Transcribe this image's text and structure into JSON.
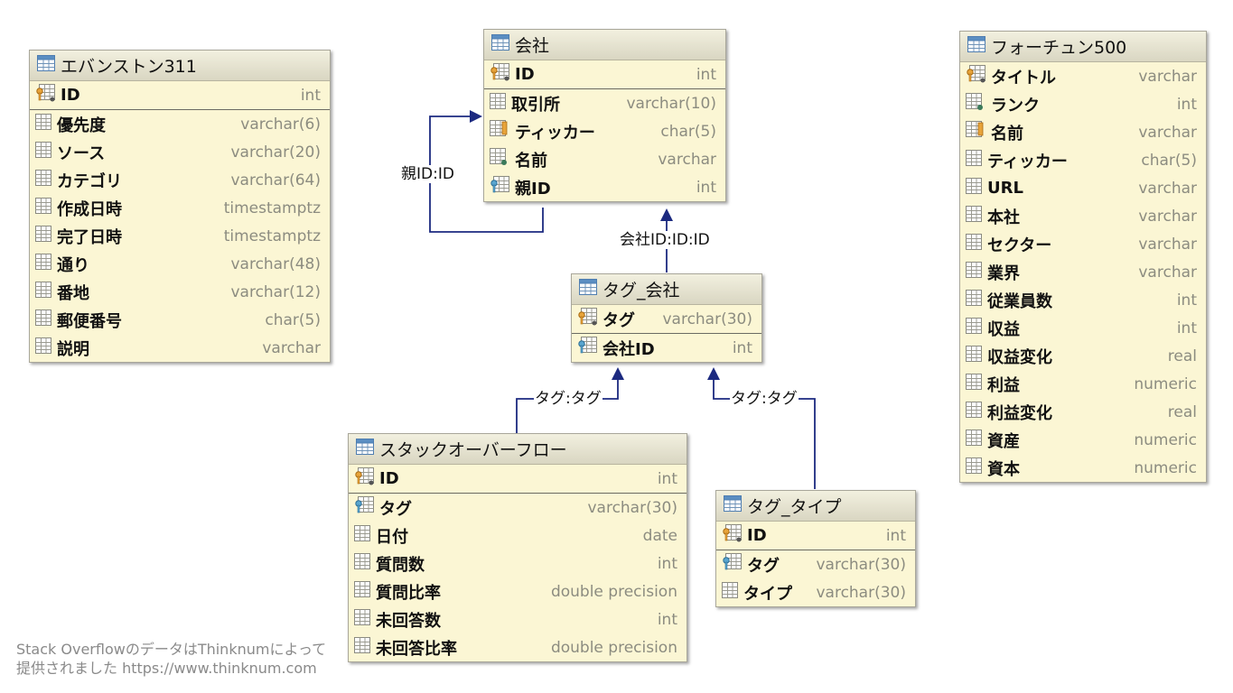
{
  "tables": [
    {
      "id": "evanston",
      "title": "エバンストン311",
      "pk": [
        {
          "name": "ID",
          "type": "int",
          "icon": "pk"
        }
      ],
      "columns": [
        {
          "name": "優先度",
          "type": "varchar(6)",
          "icon": "col"
        },
        {
          "name": "ソース",
          "type": "varchar(20)",
          "icon": "col"
        },
        {
          "name": "カテゴリ",
          "type": "varchar(64)",
          "icon": "col"
        },
        {
          "name": "作成日時",
          "type": "timestamptz",
          "icon": "col"
        },
        {
          "name": "完了日時",
          "type": "timestamptz",
          "icon": "col"
        },
        {
          "name": "通り",
          "type": "varchar(48)",
          "icon": "col"
        },
        {
          "name": "番地",
          "type": "varchar(12)",
          "icon": "col"
        },
        {
          "name": "郵便番号",
          "type": "char(5)",
          "icon": "col"
        },
        {
          "name": "説明",
          "type": "varchar",
          "icon": "col"
        }
      ]
    },
    {
      "id": "company",
      "title": "会社",
      "pk": [
        {
          "name": "ID",
          "type": "int",
          "icon": "pk"
        }
      ],
      "columns": [
        {
          "name": "取引所",
          "type": "varchar(10)",
          "icon": "col"
        },
        {
          "name": "ティッカー",
          "type": "char(5)",
          "icon": "index"
        },
        {
          "name": "名前",
          "type": "varchar",
          "icon": "nullable"
        },
        {
          "name": "親ID",
          "type": "int",
          "icon": "fk"
        }
      ]
    },
    {
      "id": "tag_company",
      "title": "タグ_会社",
      "pk": [
        {
          "name": "タグ",
          "type": "varchar(30)",
          "icon": "pk"
        }
      ],
      "columns": [
        {
          "name": "会社ID",
          "type": "int",
          "icon": "fk"
        }
      ]
    },
    {
      "id": "stackoverflow",
      "title": "スタックオーバーフロー",
      "pk": [
        {
          "name": "ID",
          "type": "int",
          "icon": "pk"
        }
      ],
      "columns": [
        {
          "name": "タグ",
          "type": "varchar(30)",
          "icon": "fk"
        },
        {
          "name": "日付",
          "type": "date",
          "icon": "col"
        },
        {
          "name": "質問数",
          "type": "int",
          "icon": "col"
        },
        {
          "name": "質問比率",
          "type": "double precision",
          "icon": "col"
        },
        {
          "name": "未回答数",
          "type": "int",
          "icon": "col"
        },
        {
          "name": "未回答比率",
          "type": "double precision",
          "icon": "col"
        }
      ]
    },
    {
      "id": "tag_type",
      "title": "タグ_タイプ",
      "pk": [
        {
          "name": "ID",
          "type": "int",
          "icon": "pk"
        }
      ],
      "columns": [
        {
          "name": "タグ",
          "type": "varchar(30)",
          "icon": "fk"
        },
        {
          "name": "タイプ",
          "type": "varchar(30)",
          "icon": "col"
        }
      ]
    },
    {
      "id": "fortune500",
      "title": "フォーチュン500",
      "pk": [],
      "columns": [
        {
          "name": "タイトル",
          "type": "varchar",
          "icon": "pk"
        },
        {
          "name": "ランク",
          "type": "int",
          "icon": "nullable"
        },
        {
          "name": "名前",
          "type": "varchar",
          "icon": "index"
        },
        {
          "name": "ティッカー",
          "type": "char(5)",
          "icon": "col"
        },
        {
          "name": "URL",
          "type": "varchar",
          "icon": "col"
        },
        {
          "name": "本社",
          "type": "varchar",
          "icon": "col"
        },
        {
          "name": "セクター",
          "type": "varchar",
          "icon": "col"
        },
        {
          "name": "業界",
          "type": "varchar",
          "icon": "col"
        },
        {
          "name": "従業員数",
          "type": "int",
          "icon": "col"
        },
        {
          "name": "収益",
          "type": "int",
          "icon": "col"
        },
        {
          "name": "収益変化",
          "type": "real",
          "icon": "col"
        },
        {
          "name": "利益",
          "type": "numeric",
          "icon": "col"
        },
        {
          "name": "利益変化",
          "type": "real",
          "icon": "col"
        },
        {
          "name": "資産",
          "type": "numeric",
          "icon": "col"
        },
        {
          "name": "資本",
          "type": "numeric",
          "icon": "col"
        }
      ]
    }
  ],
  "relations": [
    {
      "id": "company-parent",
      "label": "親ID:ID"
    },
    {
      "id": "tagcompany-company",
      "label": "会社ID:ID:ID"
    },
    {
      "id": "stackoverflow-tagcompany",
      "label": "タグ:タグ"
    },
    {
      "id": "tagtype-tagcompany",
      "label": "タグ:タグ"
    }
  ],
  "footer": {
    "line1": "Stack OverflowのデータはThinknumによって",
    "line2": "提供されました https://www.thinknum.com"
  },
  "colors": {
    "connector": "#1c2a80",
    "entity_bg": "#fbf6d4",
    "type_text": "#8c8c80"
  }
}
